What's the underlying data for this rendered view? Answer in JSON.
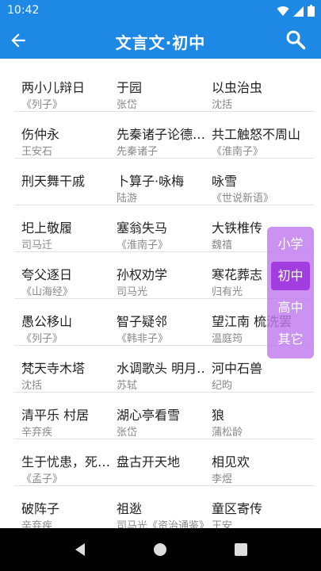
{
  "status": {
    "time": "10:42"
  },
  "app_bar": {
    "title": "文言文·初中"
  },
  "rows": [
    [
      {
        "title": "两小儿辩日",
        "author": "《列子》"
      },
      {
        "title": "于园",
        "author": "张岱"
      },
      {
        "title": "以虫治虫",
        "author": "沈括"
      }
    ],
    [
      {
        "title": "伤仲永",
        "author": "王安石"
      },
      {
        "title": "先秦诸子论德…",
        "author": "先秦诸子"
      },
      {
        "title": "共工触怒不周山",
        "author": "《淮南子》"
      }
    ],
    [
      {
        "title": "刑天舞干戚",
        "author": ""
      },
      {
        "title": "卜算子·咏梅",
        "author": "陆游"
      },
      {
        "title": "咏雪",
        "author": "《世说新语》"
      }
    ],
    [
      {
        "title": "圯上敬履",
        "author": "司马迁"
      },
      {
        "title": "塞翁失马",
        "author": "《淮南子》"
      },
      {
        "title": "大铁椎传",
        "author": "魏禧"
      }
    ],
    [
      {
        "title": "夸父逐日",
        "author": "《山海经》"
      },
      {
        "title": "孙权劝学",
        "author": "司马光"
      },
      {
        "title": "寒花葬志",
        "author": "归有光"
      }
    ],
    [
      {
        "title": "愚公移山",
        "author": "《列子》"
      },
      {
        "title": "智子疑邻",
        "author": "《韩非子》"
      },
      {
        "title": "望江南 梳洗罢",
        "author": "温庭筠"
      }
    ],
    [
      {
        "title": "梵天寺木塔",
        "author": "沈括"
      },
      {
        "title": "水调歌头 明月…",
        "author": "苏轼"
      },
      {
        "title": "河中石兽",
        "author": "纪昀"
      }
    ],
    [
      {
        "title": "清平乐 村居",
        "author": "辛弃疾"
      },
      {
        "title": "湖心亭看雪",
        "author": "张岱"
      },
      {
        "title": "狼",
        "author": "蒲松龄"
      }
    ],
    [
      {
        "title": "生于忧患，死…",
        "author": "《孟子》"
      },
      {
        "title": "盘古开天地",
        "author": ""
      },
      {
        "title": "相见欢",
        "author": "李煜"
      }
    ],
    [
      {
        "title": "破阵子",
        "author": "辛弃疾"
      },
      {
        "title": "祖逖",
        "author": "司马光《资治通鉴》"
      },
      {
        "title": "童区寄传",
        "author": "王安"
      }
    ]
  ],
  "levels": {
    "items": [
      "小学",
      "初中",
      "高中",
      "其它"
    ],
    "selected": "初中"
  },
  "colors": {
    "primary": "#1E88E5",
    "level_panel": "#C07AEE",
    "level_active": "#A43DE0"
  },
  "icons": {
    "back": "arrow-left-icon",
    "search": "search-icon",
    "wifi": "wifi-icon",
    "signal": "signal-icon",
    "battery": "battery-icon"
  }
}
